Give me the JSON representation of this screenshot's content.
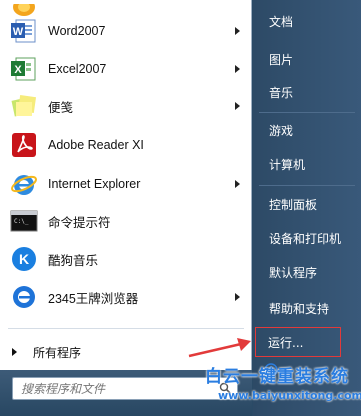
{
  "programs": [
    {
      "label": "Word2007",
      "icon": "word-icon",
      "submenu": true
    },
    {
      "label": "Excel2007",
      "icon": "excel-icon",
      "submenu": true
    },
    {
      "label": "便笺",
      "icon": "sticky-notes-icon",
      "submenu": true
    },
    {
      "label": "Adobe Reader XI",
      "icon": "adobe-reader-icon",
      "submenu": false
    },
    {
      "label": "Internet Explorer",
      "icon": "internet-explorer-icon",
      "submenu": true
    },
    {
      "label": "命令提示符",
      "icon": "command-prompt-icon",
      "submenu": false
    },
    {
      "label": "酷狗音乐",
      "icon": "kugou-music-icon",
      "submenu": false
    },
    {
      "label": "2345王牌浏览器",
      "icon": "browser-2345-icon",
      "submenu": true
    }
  ],
  "all_programs_label": "所有程序",
  "search": {
    "placeholder": "搜索程序和文件"
  },
  "right_items": [
    {
      "label": "文档"
    },
    {
      "label": "图片"
    },
    {
      "label": "音乐"
    },
    {
      "label": "游戏"
    },
    {
      "label": "计算机"
    },
    {
      "label": "控制面板"
    },
    {
      "label": "设备和打印机"
    },
    {
      "label": "默认程序"
    },
    {
      "label": "帮助和支持"
    },
    {
      "label": "运行..."
    }
  ],
  "watermark": {
    "title": "白云一键重装系统",
    "url": "www.baiyunxitong.com"
  },
  "colors": {
    "annotation_red": "#e23a3a",
    "watermark_blue": "#2a7de0",
    "right_pane": "#2d4a66"
  }
}
